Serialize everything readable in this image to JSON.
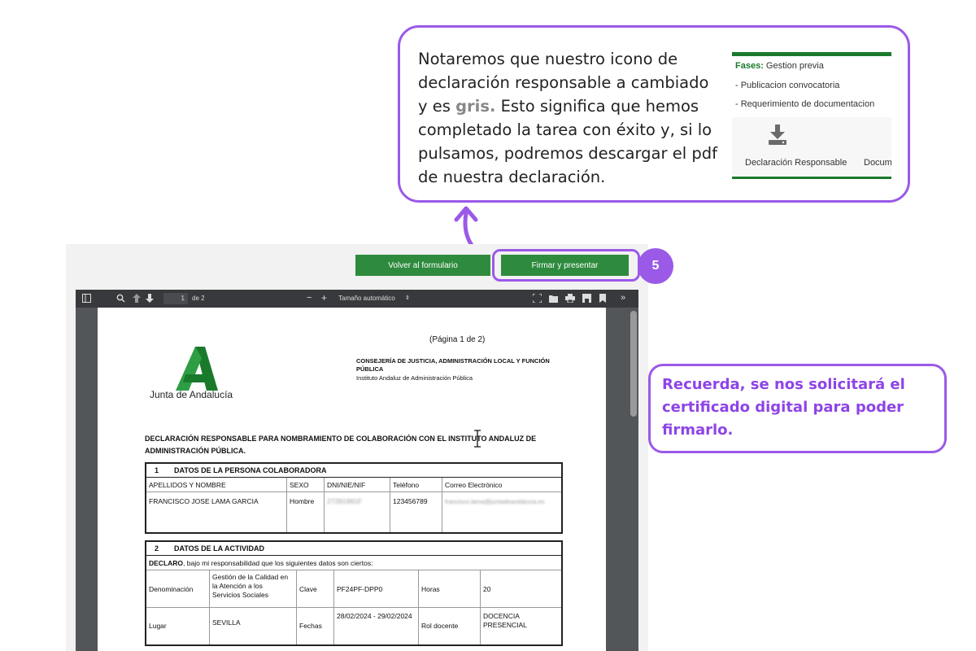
{
  "callout_top": {
    "text_before": "Notaremos que nuestro icono de declaración responsable a cambiado y es ",
    "text_highlight": "gris.",
    "text_after": " Esto significa que hemos completado la tarea con éxito y, si lo pulsamos, podremos descargar el pdf de nuestra declaración."
  },
  "inset": {
    "phase_label": "Fases:",
    "phase_value": " Gestion previa",
    "item1": "- Publicacion convocatoria",
    "item2": "- Requerimiento de documentacion",
    "download_label": "Declaración Responsable",
    "doc_label": "Docum",
    "icon": "download-icon"
  },
  "toolbar": {
    "back_button": "Volver al formulario",
    "sign_button": "Firmar y presentar",
    "step_number": "5"
  },
  "viewer": {
    "page_current": "1",
    "page_total": "de 2",
    "zoom_minus": "−",
    "zoom_plus": "+",
    "zoom_label": "Tamaño automático",
    "more": "»"
  },
  "pdf": {
    "page_indicator": "(Página 1 de 2)",
    "logo_text": "Junta de Andalucía",
    "ministry": "CONSEJERÍA DE JUSTICIA, ADMINISTRACIÓN LOCAL Y FUNCIÓN PÚBLICA",
    "institute": "Instituto Andaluz de Administración Pública",
    "title": "DECLARACIÓN RESPONSABLE PARA NOMBRAMIENTO DE COLABORACIÓN CON EL INSTITUTO ANDALUZ DE ADMINISTRACIÓN PÚBLICA.",
    "section1": {
      "number": "1",
      "title": "DATOS DE LA PERSONA COLABORADORA",
      "headers": [
        "APELLIDOS Y NOMBRE",
        "SEXO",
        "DNI/NIE/NIF",
        "Teléfono",
        "Correo Electrónico"
      ],
      "values": [
        "FRANCISCO JOSE LAMA GARCIA",
        "Hombre",
        "27291991F",
        "123456789",
        "francisco.lama@juntadeandalucia.es"
      ]
    },
    "section2": {
      "number": "2",
      "title": "DATOS DE LA ACTIVIDAD",
      "declaro_bold": "DECLARO",
      "declaro_rest": ", bajo mi responsabilidad que los siguientes datos son ciertos:",
      "denominacion_label": "Denominación",
      "denominacion_value": "Gestión de la Calidad en la Atención a los Servicios Sociales",
      "clave_label": "Clave",
      "clave_value": "PF24PF-DPP0",
      "horas_label": "Horas",
      "horas_value": "20",
      "lugar_label": "Lugar",
      "lugar_value": "SEVILLA",
      "fechas_label": "Fechas",
      "fechas_value": "28/02/2024 - 29/02/2024",
      "rol_label": "Rol docente",
      "rol_value": "DOCENCIA PRESENCIAL"
    }
  },
  "callout_right": {
    "text": " Recuerda, se nos solicitará el certificado digital para poder firmarlo."
  },
  "colors": {
    "accent_purple": "#9b59e8",
    "button_green": "#2e8b3d",
    "junta_green": "#1a7a2c"
  }
}
